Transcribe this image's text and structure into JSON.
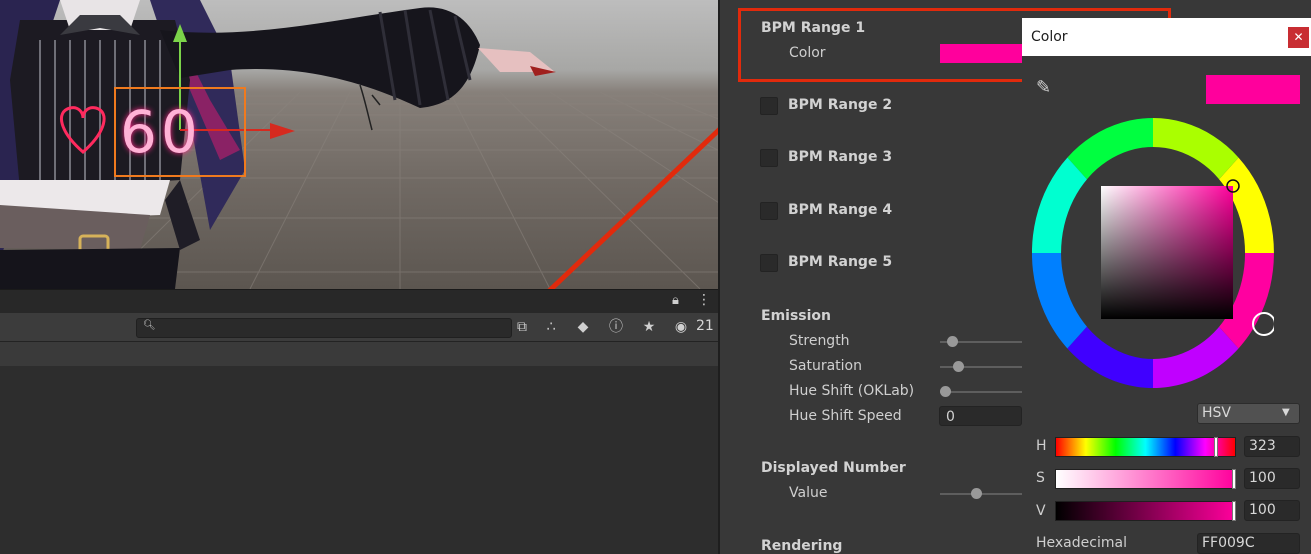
{
  "scene": {
    "display_number": "60"
  },
  "hierarchy": {
    "search": {
      "value": "",
      "placeholder": ""
    },
    "hidden_count": "21"
  },
  "inspector": {
    "bpm_ranges": [
      {
        "label": "BPM Range 1",
        "enabled": true,
        "color_label": "Color",
        "color": "#ff009c"
      },
      {
        "label": "BPM Range 2",
        "enabled": false
      },
      {
        "label": "BPM Range 3",
        "enabled": false
      },
      {
        "label": "BPM Range 4",
        "enabled": false
      },
      {
        "label": "BPM Range 5",
        "enabled": false
      }
    ],
    "emission": {
      "title": "Emission",
      "strength_label": "Strength",
      "saturation_label": "Saturation",
      "hue_shift_label": "Hue Shift (OKLab)",
      "hue_shift_speed_label": "Hue Shift Speed",
      "hue_shift_speed_value": "0"
    },
    "displayed_number": {
      "title": "Displayed Number",
      "value_label": "Value"
    },
    "rendering": {
      "title": "Rendering"
    }
  },
  "color_picker": {
    "title": "Color",
    "close_icon": "close-icon",
    "mode": "HSV",
    "h_label": "H",
    "h_value": "323",
    "s_label": "S",
    "s_value": "100",
    "v_label": "V",
    "v_value": "100",
    "hex_label": "Hexadecimal",
    "hex_value": "FF009C",
    "current_color": "#ff009c"
  },
  "colors": {
    "annotation": "#e12a0c",
    "selected": "#ff009c"
  }
}
